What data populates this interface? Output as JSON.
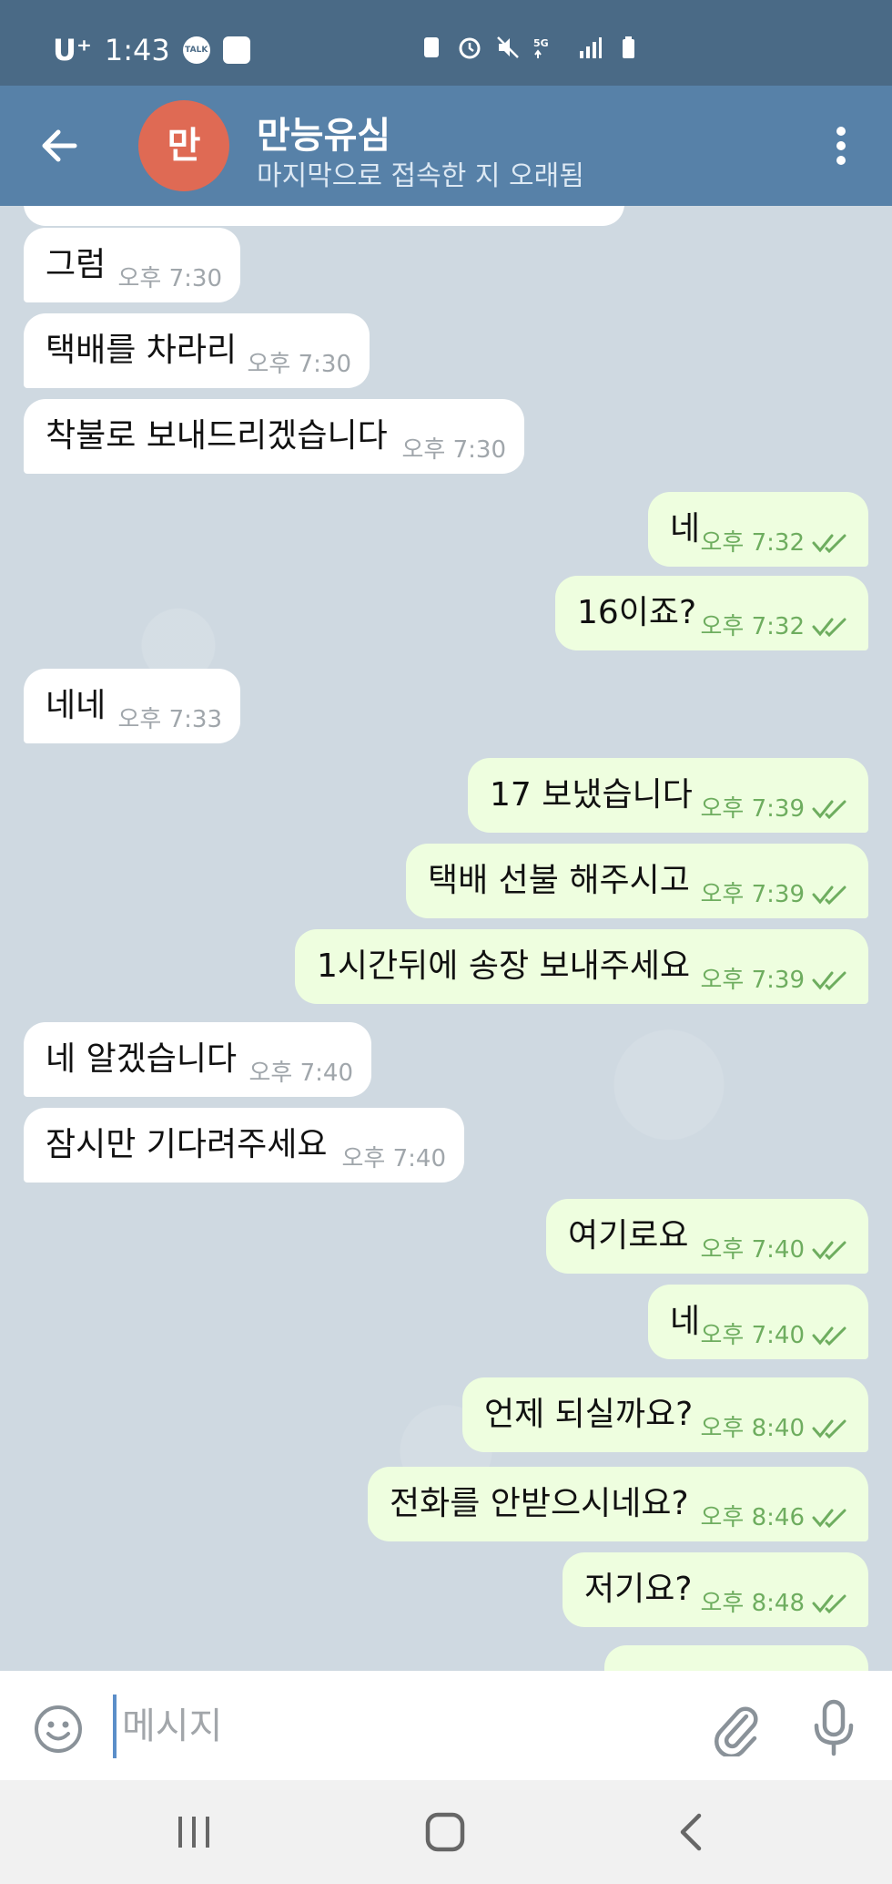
{
  "status_bar": {
    "carrier": "U⁺",
    "time": "1:43",
    "talk_icon_label": "TALK",
    "network": "5G"
  },
  "header": {
    "avatar_letter": "만",
    "contact_name": "만능유심",
    "contact_status": "마지막으로 접속한 지 오래됨",
    "avatar_color": "#df6a54"
  },
  "messages": [
    {
      "dir": "in",
      "text": "그럼",
      "time": "오후 7:30"
    },
    {
      "dir": "in",
      "text": "택배를 차라리",
      "time": "오후 7:30"
    },
    {
      "dir": "in",
      "text": "착불로 보내드리겠습니다",
      "time": "오후 7:30"
    },
    {
      "dir": "out",
      "text": "네",
      "time": "오후 7:32"
    },
    {
      "dir": "out",
      "text": "16이죠?",
      "time": "오후 7:32"
    },
    {
      "dir": "in",
      "text": "네네",
      "time": "오후 7:33"
    },
    {
      "dir": "out",
      "text": "17 보냈습니다",
      "time": "오후 7:39"
    },
    {
      "dir": "out",
      "text": "택배 선불 해주시고",
      "time": "오후 7:39"
    },
    {
      "dir": "out",
      "text": "1시간뒤에 송장 보내주세요",
      "time": "오후 7:39"
    },
    {
      "dir": "in",
      "text": "네 알겠습니다",
      "time": "오후 7:40"
    },
    {
      "dir": "in",
      "text": "잠시만 기다려주세요",
      "time": "오후 7:40"
    },
    {
      "dir": "out",
      "text": "여기로요",
      "time": "오후 7:40"
    },
    {
      "dir": "out",
      "text": "네",
      "time": "오후 7:40"
    },
    {
      "dir": "out",
      "text": "언제 되실까요?",
      "time": "오후 8:40"
    },
    {
      "dir": "out",
      "text": "전화를 안받으시네요?",
      "time": "오후 8:46"
    },
    {
      "dir": "out",
      "text": "저기요?",
      "time": "오후 8:48"
    }
  ],
  "input": {
    "placeholder": "메시지",
    "value": ""
  },
  "colors": {
    "header_bg": "#5781a8",
    "status_bg": "#4a6a86",
    "outgoing_bubble": "#eefedf",
    "incoming_bubble": "#ffffff",
    "read_check": "#6ead5f"
  },
  "icons": {
    "back": "arrow-left-icon",
    "menu": "more-vertical-icon",
    "emoji": "smile-icon",
    "attach": "paperclip-icon",
    "mic": "microphone-icon",
    "read_status": "double-check-icon"
  }
}
